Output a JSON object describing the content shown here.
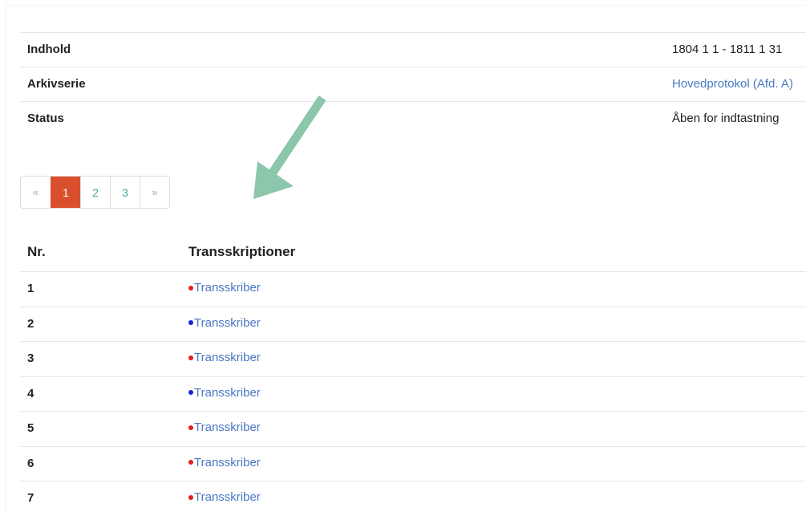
{
  "info": {
    "rows": [
      {
        "label": "Indhold",
        "value": "1804 1 1 - 1811 1 31",
        "is_link": false
      },
      {
        "label": "Arkivserie",
        "value": "Hovedprotokol (Afd. A)",
        "is_link": true
      },
      {
        "label": "Status",
        "value": "Åben for indtastning",
        "is_link": false
      }
    ]
  },
  "pagination": {
    "prev": "«",
    "pages": [
      "1",
      "2",
      "3"
    ],
    "active": "1",
    "next": "»",
    "active_color": "#d9502f"
  },
  "arrow": {
    "icon": "down-left-arrow-icon",
    "color": "#8cc6ab"
  },
  "transcriptions": {
    "headers": {
      "nr": "Nr.",
      "transcriptions": "Transskriptioner"
    },
    "link_label": "Transskriber",
    "rows": [
      {
        "nr": "1",
        "status_color": "#e0201b",
        "link": "Transskriber"
      },
      {
        "nr": "2",
        "status_color": "#1a23d8",
        "link": "Transskriber"
      },
      {
        "nr": "3",
        "status_color": "#e0201b",
        "link": "Transskriber"
      },
      {
        "nr": "4",
        "status_color": "#1a23d8",
        "link": "Transskriber"
      },
      {
        "nr": "5",
        "status_color": "#e0201b",
        "link": "Transskriber"
      },
      {
        "nr": "6",
        "status_color": "#e0201b",
        "link": "Transskriber"
      },
      {
        "nr": "7",
        "status_color": "#e0201b",
        "link": "Transskriber"
      }
    ]
  }
}
